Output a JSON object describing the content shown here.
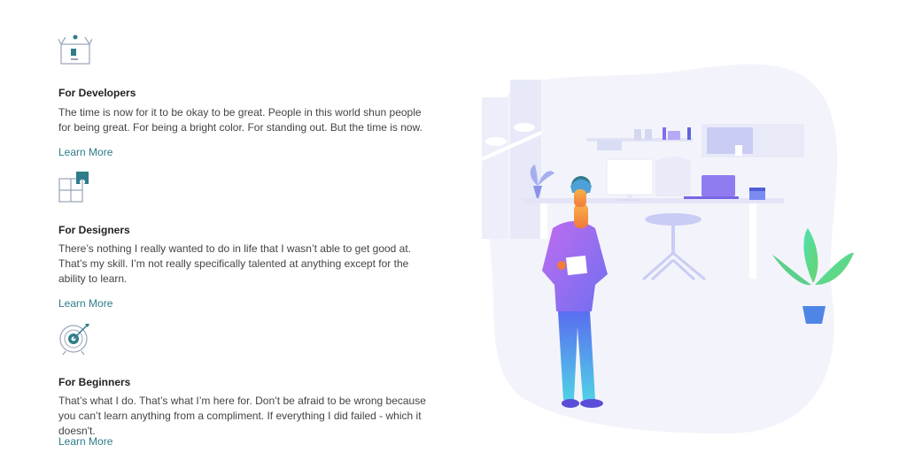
{
  "features": [
    {
      "icon": "open-box-icon",
      "title": "For Developers",
      "description": "The time is now for it to be okay to be great. People in this world shun people for being great. For being a bright color. For standing out. But the time is now.",
      "link": "Learn More"
    },
    {
      "icon": "puzzle-icon",
      "title": "For Designers",
      "description": "There’s nothing I really wanted to do in life that I wasn’t able to get good at. That’s my skill. I’m not really specifically talented at anything except for the ability to learn.",
      "link": "Learn More"
    },
    {
      "icon": "target-icon",
      "title": "For Beginners",
      "description": "That’s what I do. That’s what I’m here for. Don’t be afraid to be wrong because you can’t learn anything from a compliment. If everything I did failed - which it doesn't.",
      "link": "Learn More"
    }
  ],
  "colors": {
    "accent": "#2f7c8a",
    "illustration_primary": "#8f7cf0",
    "illustration_bg": "#f3f4fb"
  }
}
